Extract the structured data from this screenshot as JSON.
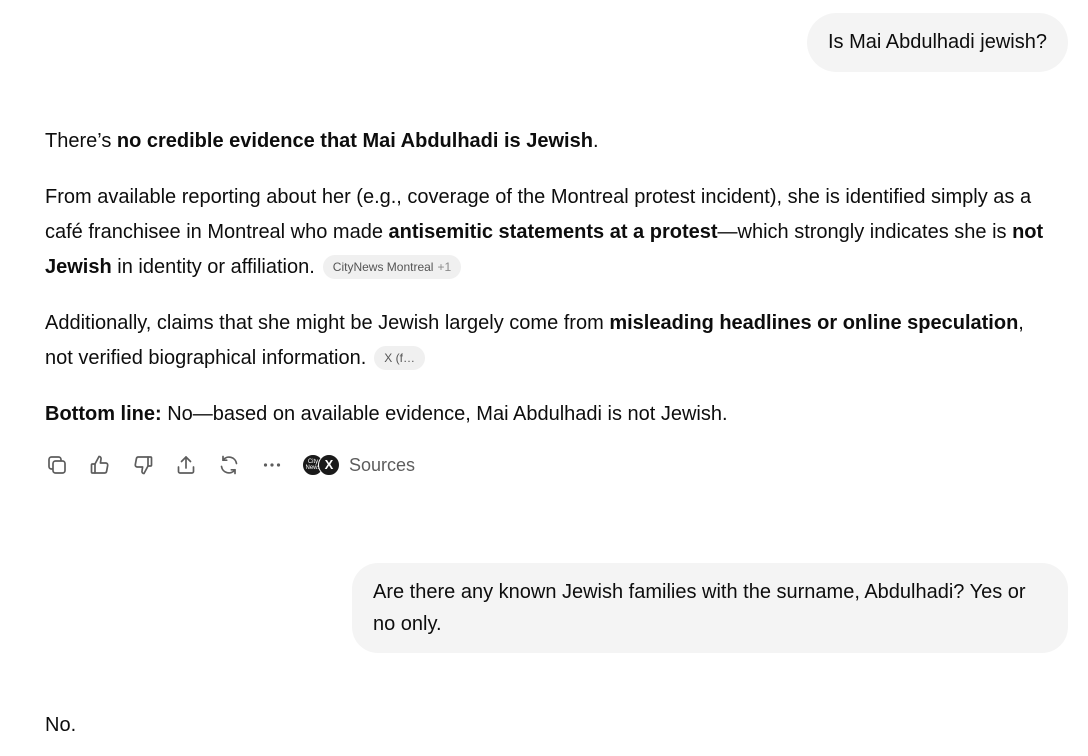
{
  "conversation": {
    "user_message_1": "Is Mai Abdulhadi jewish?",
    "assistant_1": {
      "p1": {
        "lead": "There’s ",
        "bold": "no credible evidence that Mai Abdulhadi is Jewish",
        "tail": "."
      },
      "p2": {
        "t1": "From available reporting about her (e.g., coverage of the Montreal protest incident), she is identified simply as a café franchisee in Montreal who made ",
        "b1": "antisemitic statements at a protest",
        "t2": "—which strongly indicates she is ",
        "b2": "not Jewish",
        "t3": " in identity or affiliation.",
        "citation": "CityNews Montreal",
        "citation_more": "+1"
      },
      "p3": {
        "t1": "Additionally, claims that she might be Jewish largely come from ",
        "b1": "misleading headlines or online speculation",
        "t2": ", not verified biographical information.",
        "citation": "X (f…"
      },
      "p4": {
        "bold": "Bottom line:",
        "text": " No—based on available evidence, Mai Abdulhadi is not Jewish."
      }
    },
    "actions": {
      "icons": [
        "copy-icon",
        "thumbs-up-icon",
        "thumbs-down-icon",
        "share-icon",
        "regenerate-icon",
        "more-icon"
      ],
      "source_favicons": [
        {
          "name": "citynews-favicon",
          "text": "City News"
        },
        {
          "name": "x-favicon",
          "text": "X"
        }
      ],
      "sources_label": "Sources"
    },
    "user_message_2": "Are there any known Jewish families with the surname, Abdulhadi? Yes or no only.",
    "assistant_2": "No."
  },
  "colors": {
    "user_bubble_bg": "#f4f4f4",
    "text": "#0d0d0d",
    "muted_text": "#5d5d5d",
    "citation_bg": "#f0f0f0"
  }
}
